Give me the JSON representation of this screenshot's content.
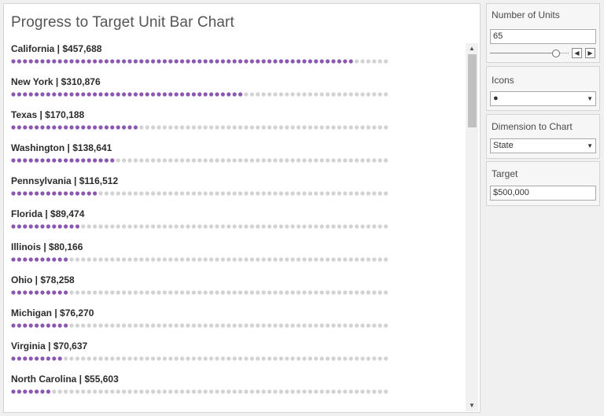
{
  "chart_data": {
    "type": "unit-bar",
    "title": "Progress to Target Unit Bar Chart",
    "target": 500000,
    "units": 65,
    "unit_value": 7692.3,
    "filled_color": "#8a58b2",
    "empty_color": "#d2d2d2",
    "categories": [
      "California",
      "New York",
      "Texas",
      "Washington",
      "Pennsylvania",
      "Florida",
      "Illinois",
      "Ohio",
      "Michigan",
      "Virginia",
      "North Carolina"
    ],
    "values": [
      457688,
      310876,
      170188,
      138641,
      116512,
      89474,
      80166,
      78258,
      76270,
      70637,
      55603
    ],
    "labels": [
      "California | $457,688",
      "New York | $310,876",
      "Texas | $170,188",
      "Washington | $138,641",
      "Pennsylvania | $116,512",
      "Florida | $89,474",
      "Illinois | $80,166",
      "Ohio | $78,258",
      "Michigan | $76,270",
      "Virginia | $70,637",
      "North Carolina | $55,603"
    ]
  },
  "controls": {
    "units": {
      "title": "Number of Units",
      "value": "65",
      "slider_fraction": 0.84
    },
    "icons": {
      "title": "Icons",
      "value": "●"
    },
    "dimension": {
      "title": "Dimension to Chart",
      "value": "State"
    },
    "target": {
      "title": "Target",
      "value": "$500,000"
    }
  }
}
